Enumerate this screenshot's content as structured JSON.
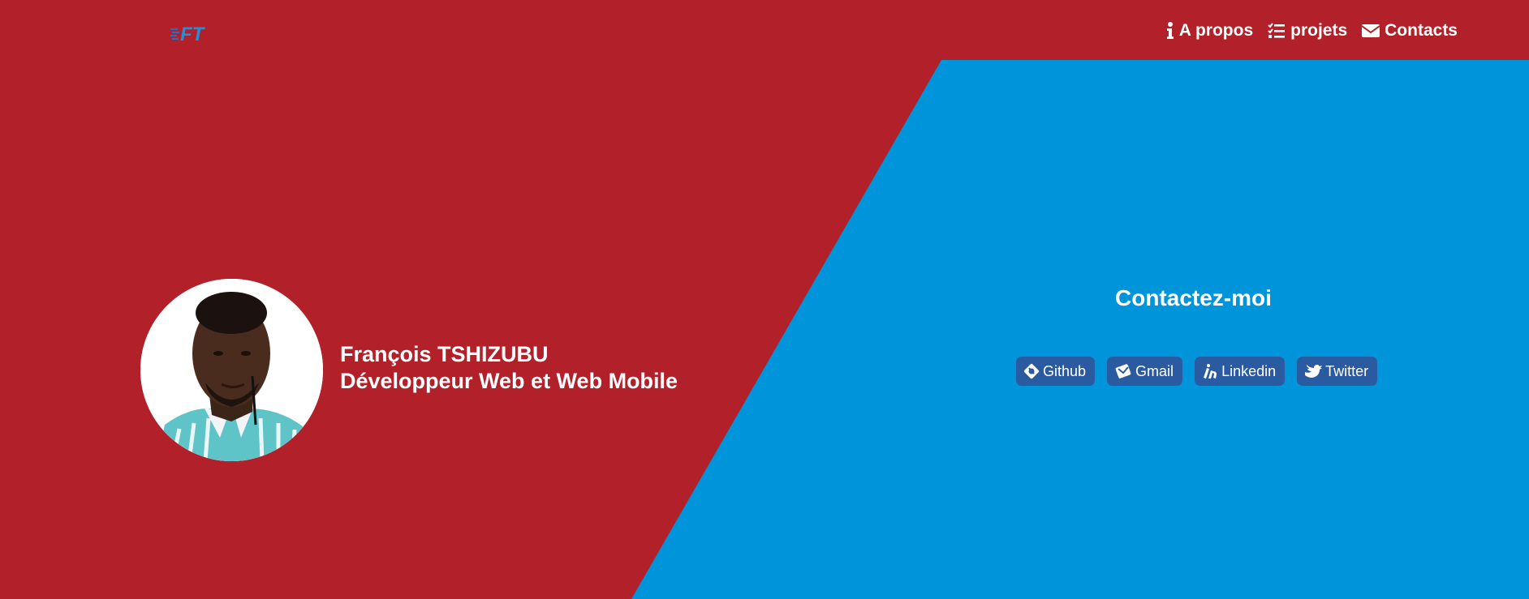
{
  "logo": {
    "text": "FT"
  },
  "nav": {
    "items": [
      {
        "icon": "info-icon",
        "label": "A propos"
      },
      {
        "icon": "checklist-icon",
        "label": "projets"
      },
      {
        "icon": "envelope-icon",
        "label": "Contacts"
      }
    ]
  },
  "profile": {
    "name": "François TSHIZUBU",
    "role": "Développeur Web et Web Mobile"
  },
  "contact": {
    "title": "Contactez-moi",
    "links": [
      {
        "icon": "github-icon",
        "label": "Github"
      },
      {
        "icon": "gmail-icon",
        "label": "Gmail"
      },
      {
        "icon": "linkedin-icon",
        "label": "Linkedin"
      },
      {
        "icon": "twitter-icon",
        "label": "Twitter"
      }
    ]
  },
  "colors": {
    "red_background": "#b22029",
    "blue_panel": "#0094da",
    "button_background": "#2a5a9f"
  }
}
